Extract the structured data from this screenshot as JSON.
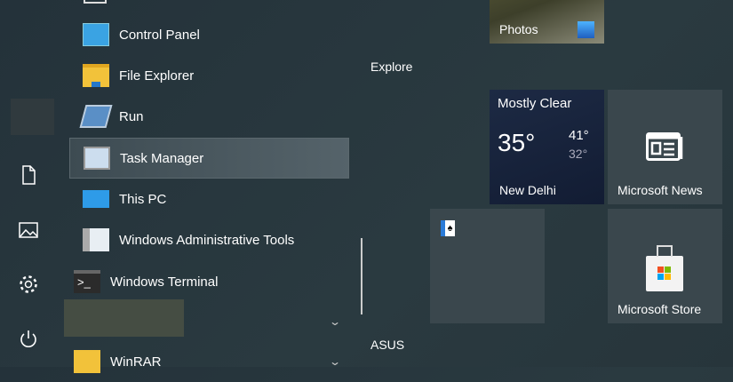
{
  "app_list": {
    "items": [
      {
        "label": "Control Panel",
        "icon": "control-panel-icon"
      },
      {
        "label": "File Explorer",
        "icon": "folder-icon"
      },
      {
        "label": "Run",
        "icon": "run-icon"
      },
      {
        "label": "Task Manager",
        "icon": "task-manager-icon"
      },
      {
        "label": "This PC",
        "icon": "computer-icon"
      },
      {
        "label": "Windows Administrative Tools",
        "icon": "admin-tools-icon"
      }
    ],
    "terminal": "Windows Terminal",
    "winrar": "WinRAR"
  },
  "tiles": {
    "photos": "Photos",
    "explore_group": "Explore",
    "weather": {
      "condition": "Mostly Clear",
      "temp": "35°",
      "high": "41°",
      "low": "32°",
      "city": "New Delhi"
    },
    "news": "Microsoft News",
    "store": "Microsoft Store",
    "asus_group": "ASUS"
  }
}
